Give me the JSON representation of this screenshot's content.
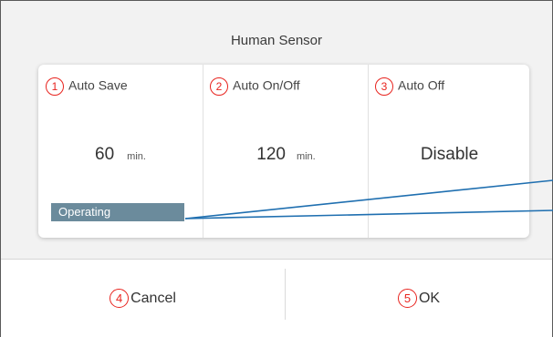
{
  "title": "Human Sensor",
  "columns": [
    {
      "marker": "1",
      "label": "Auto Save",
      "value": "60",
      "unit": "min."
    },
    {
      "marker": "2",
      "label": "Auto On/Off",
      "value": "120",
      "unit": "min."
    },
    {
      "marker": "3",
      "label": "Auto Off",
      "value": "Disable",
      "unit": ""
    }
  ],
  "status_badge": "Operating",
  "buttons": {
    "cancel": {
      "marker": "4",
      "label": "Cancel"
    },
    "ok": {
      "marker": "5",
      "label": "OK"
    }
  },
  "colors": {
    "marker": "#e8231e",
    "badge": "#6b8b9c",
    "callout_line": "#1f6fb0"
  }
}
